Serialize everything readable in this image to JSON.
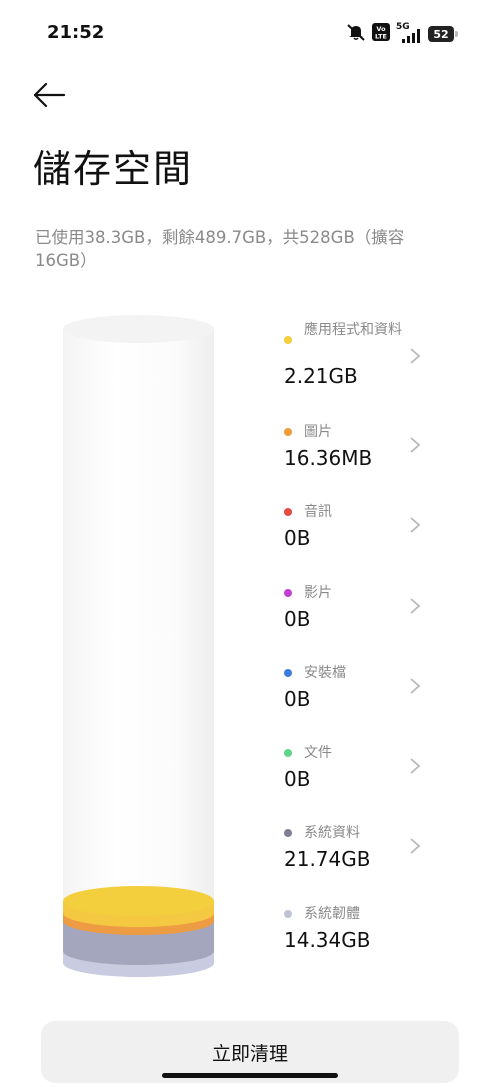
{
  "status_bar": {
    "time": "21:52",
    "network": "5G",
    "volte_label": "VoLTE",
    "battery": "52"
  },
  "header": {
    "back_icon": "arrow-left-icon",
    "title": "儲存空間"
  },
  "summary": "已使用38.3GB，剩餘489.7GB，共528GB（擴容16GB）",
  "categories": [
    {
      "label": "應用程式和資料",
      "size": "2.21GB",
      "color": "#F3CF3D",
      "has_chevron": true
    },
    {
      "label": "圖片",
      "size": "16.36MB",
      "color": "#F09A3E",
      "has_chevron": true
    },
    {
      "label": "音訊",
      "size": "0B",
      "color": "#E5493F",
      "has_chevron": true
    },
    {
      "label": "影片",
      "size": "0B",
      "color": "#C23FD3",
      "has_chevron": true
    },
    {
      "label": "安裝檔",
      "size": "0B",
      "color": "#3F7CE0",
      "has_chevron": true
    },
    {
      "label": "文件",
      "size": "0B",
      "color": "#5ED68A",
      "has_chevron": true
    },
    {
      "label": "系統資料",
      "size": "21.74GB",
      "color": "#7C7F96",
      "has_chevron": true
    },
    {
      "label": "系統韌體",
      "size": "14.34GB",
      "color": "#BFC3D8",
      "has_chevron": false
    }
  ],
  "actions": {
    "clean_label": "立即清理"
  }
}
